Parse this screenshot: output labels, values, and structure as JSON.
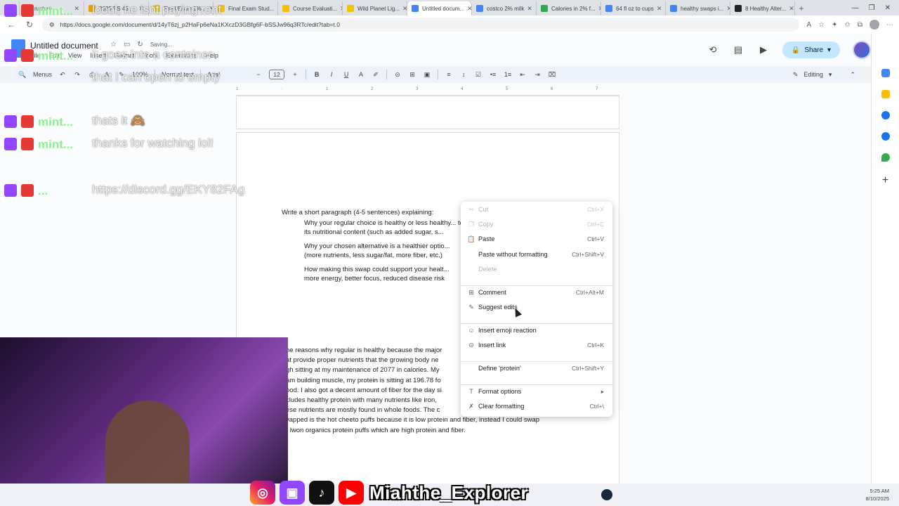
{
  "browser": {
    "tabs": [
      {
        "label": "ructure",
        "color": "#c4314b",
        "active": false
      },
      {
        "label": "2025 PS 48...",
        "color": "#e8a000",
        "active": false
      },
      {
        "label": "Final Exam 1%...",
        "color": "#f2c200",
        "active": false
      },
      {
        "label": "Final Exam Stud...",
        "color": "#f2c200",
        "active": false
      },
      {
        "label": "Course Evaluati...",
        "color": "#f2c200",
        "active": false
      },
      {
        "label": "Wild Planet Lig...",
        "color": "#f2c200",
        "active": false
      },
      {
        "label": "Untitled docum...",
        "color": "#4285f4",
        "active": true
      },
      {
        "label": "costco 2% milk",
        "color": "#4285f4",
        "active": false
      },
      {
        "label": "Calories in 2% f...",
        "color": "#34a853",
        "active": false
      },
      {
        "label": "64 fl oz to cups",
        "color": "#4285f4",
        "active": false
      },
      {
        "label": "healthy swaps i...",
        "color": "#4285f4",
        "active": false
      },
      {
        "label": "8 Healthy Alter...",
        "color": "#202124",
        "active": false
      }
    ],
    "new_tab": "+",
    "url": "https://docs.google.com/document/d/14yT6zj_p2HaFp6eNa1KXczD3GBfg6F-bSSJw96q3RTc/edit?tab=t.0"
  },
  "docs": {
    "title": "Untitled document",
    "saving": "Saving...",
    "menu": [
      "File",
      "Edit",
      "View",
      "Insert",
      "Format",
      "Tools",
      "Extensions",
      "Help"
    ],
    "share_label": "Share",
    "toolbar": {
      "menus": "Menus",
      "zoom": "100%",
      "style": "Normal text",
      "font": "Arial",
      "font_size": "12",
      "editing": "Editing"
    }
  },
  "document": {
    "prompt": "Write a short paragraph (4-5 sentences) explaining:",
    "bullets": [
      "Why your regular choice is healthy or less healthy... to its nutritional content (such as added sugar, s...",
      "Why your chosen alternative is a healthier optio... (more nutrients, less sugar/fat, more fiber, etc.)",
      "How making this swap could support your healt... more energy, better focus, reduced disease risk"
    ],
    "answer_lines": [
      "he reasons why regular is healthy because the major",
      "at provide proper nutrients that the growing body ne",
      "gh sitting at my maintenance of 2077 in calories. My",
      "am building muscle, my protein is sitting at 196.78 fo",
      "ood. I also got a decent amount of fiber for the day si",
      "cludes healthy protein with many nutrients like iron,",
      "ese nutrients are mostly found in whole foods. The c",
      "vapped is the hot cheeto puffs because it is low protein and fiber, instead I could swap",
      "r lwon organics protein puffs which are high protein and fiber."
    ]
  },
  "context_menu": {
    "items": [
      {
        "label": "Cut",
        "shortcut": "Ctrl+X",
        "icon": "scissors-icon",
        "glyph": "✂",
        "disabled": true
      },
      {
        "label": "Copy",
        "shortcut": "Ctrl+C",
        "icon": "copy-icon",
        "glyph": "❐",
        "disabled": true
      },
      {
        "label": "Paste",
        "shortcut": "Ctrl+V",
        "icon": "paste-icon",
        "glyph": "📋",
        "disabled": false
      },
      {
        "label": "Paste without formatting",
        "shortcut": "Ctrl+Shift+V",
        "icon": "paste-plain-icon",
        "glyph": "",
        "disabled": false
      },
      {
        "label": "Delete",
        "shortcut": "",
        "icon": "delete-icon",
        "glyph": "",
        "disabled": true
      },
      {
        "label": "Comment",
        "shortcut": "Ctrl+Alt+M",
        "icon": "comment-icon",
        "glyph": "⊞",
        "disabled": false
      },
      {
        "label": "Suggest edits",
        "shortcut": "",
        "icon": "suggest-edits-icon",
        "glyph": "✎",
        "disabled": false
      },
      {
        "label": "Insert emoji reaction",
        "shortcut": "",
        "icon": "emoji-icon",
        "glyph": "☺",
        "disabled": false
      },
      {
        "label": "Insert link",
        "shortcut": "Ctrl+K",
        "icon": "link-icon",
        "glyph": "⊝",
        "disabled": false
      },
      {
        "label": "Define 'protein'",
        "shortcut": "Ctrl+Shift+Y",
        "icon": "define-icon",
        "glyph": "",
        "disabled": false
      },
      {
        "label": "Format options",
        "shortcut": "▸",
        "icon": "format-icon",
        "glyph": "T",
        "disabled": false
      },
      {
        "label": "Clear formatting",
        "shortcut": "Ctrl+\\",
        "icon": "clear-format-icon",
        "glyph": "✗",
        "disabled": false
      }
    ]
  },
  "stream": {
    "chat": [
      {
        "user": "mint...",
        "message": "loool, he isnt paying rent"
      },
      {
        "user": "mint...",
        "message": "it goes into a container that I can open to empty"
      },
      {
        "user": "mint...",
        "message": "thats it 🙈"
      },
      {
        "user": "mint...",
        "message": "thanks for watching lol!"
      },
      {
        "user": "...",
        "message": "https://discord.gg/EKY82FAg"
      }
    ],
    "handle": "Miahthe_Explorer"
  },
  "taskbar": {
    "time": "5:25 AM",
    "date": "8/10/2025"
  }
}
